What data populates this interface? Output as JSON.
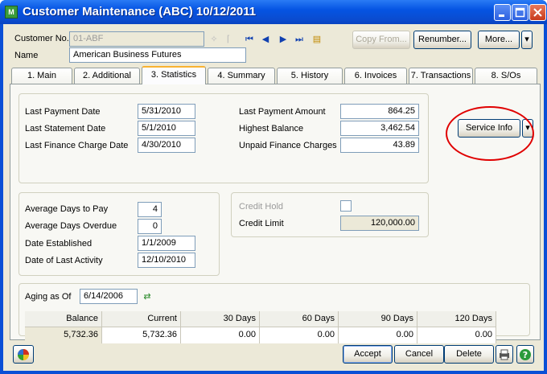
{
  "window": {
    "title": "Customer Maintenance (ABC) 10/12/2011",
    "app_icon": "spreadsheet-app-icon"
  },
  "header": {
    "customer_no_label": "Customer No.",
    "customer_no_value": "01-ABF",
    "name_label": "Name",
    "name_value": "American Business Futures",
    "copy_from": "Copy From...",
    "renumber": "Renumber...",
    "more": "More..."
  },
  "tabs": [
    {
      "label": "1. Main"
    },
    {
      "label": "2. Additional"
    },
    {
      "label": "3. Statistics"
    },
    {
      "label": "4. Summary"
    },
    {
      "label": "5. History"
    },
    {
      "label": "6. Invoices"
    },
    {
      "label": "7. Transactions"
    },
    {
      "label": "8. S/Os"
    }
  ],
  "stats": {
    "last_payment_date_label": "Last Payment Date",
    "last_payment_date": "5/31/2010",
    "last_statement_date_label": "Last Statement Date",
    "last_statement_date": "5/1/2010",
    "last_finance_charge_date_label": "Last Finance Charge Date",
    "last_finance_charge_date": "4/30/2010",
    "last_payment_amount_label": "Last Payment Amount",
    "last_payment_amount": "864.25",
    "highest_balance_label": "Highest Balance",
    "highest_balance": "3,462.54",
    "unpaid_finance_charges_label": "Unpaid Finance Charges",
    "unpaid_finance_charges": "43.89",
    "service_info": "Service Info",
    "avg_days_to_pay_label": "Average Days to Pay",
    "avg_days_to_pay": "4",
    "avg_days_overdue_label": "Average Days Overdue",
    "avg_days_overdue": "0",
    "date_established_label": "Date Established",
    "date_established": "1/1/2009",
    "date_last_activity_label": "Date of Last Activity",
    "date_last_activity": "12/10/2010",
    "credit_hold_label": "Credit Hold",
    "credit_limit_label": "Credit Limit",
    "credit_limit": "120,000.00"
  },
  "aging": {
    "label": "Aging as Of",
    "date": "6/14/2006",
    "columns": [
      "Balance",
      "Current",
      "30 Days",
      "60 Days",
      "90 Days",
      "120 Days"
    ],
    "values": [
      "5,732.36",
      "5,732.36",
      "0.00",
      "0.00",
      "0.00",
      "0.00"
    ]
  },
  "footer": {
    "accept": "Accept",
    "cancel": "Cancel",
    "delete": "Delete"
  }
}
